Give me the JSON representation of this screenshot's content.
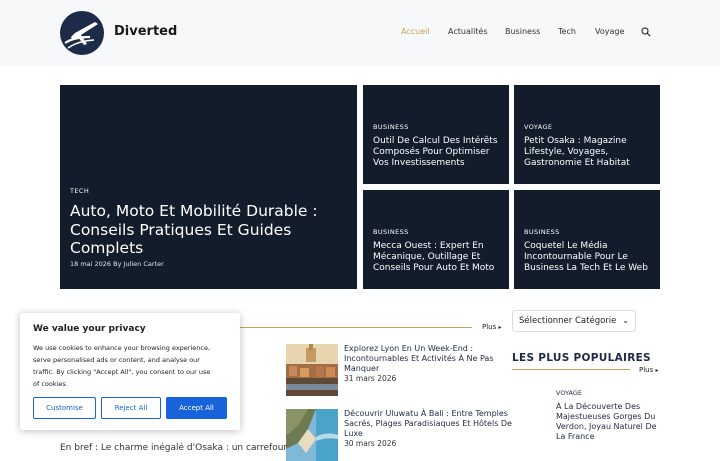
{
  "header": {
    "brand": "Diverted",
    "nav": [
      "Accueil",
      "Actualités",
      "Business",
      "Tech",
      "Voyage"
    ]
  },
  "featured": {
    "main": {
      "category": "TECH",
      "title_lines": [
        "Auto, Moto Et Mobilité Durable :",
        "Conseils Pratiques Et Guides",
        "Complets"
      ],
      "date": "18 mai 2026",
      "byline": "By Julien Carter"
    },
    "tiles": [
      {
        "category": "BUSINESS",
        "title_lines": [
          "Outil De Calcul Des Intérêts",
          "Composés Pour Optimiser",
          "Vos Investissements"
        ]
      },
      {
        "category": "VOYAGE",
        "title_lines": [
          "Petit Osaka : Magazine",
          "Lifestyle, Voyages,",
          "Gastronomie Et Habitat"
        ]
      },
      {
        "category": "BUSINESS",
        "title_lines": [
          "Mecca Ouest : Expert En",
          "Mécanique, Outillage Et",
          "Conseils Pour Auto Et Moto"
        ]
      },
      {
        "category": "BUSINESS",
        "title_lines": [
          "Coquetel Le Média",
          "Incontournable Pour Le",
          "Business La Tech Et Le Web"
        ]
      }
    ]
  },
  "section": {
    "more_label": "Plus"
  },
  "posts": [
    {
      "title_lines": [
        "Explorez Lyon En Un Week-End :",
        "Incontournables Et Activités À Ne Pas",
        "Manquer"
      ],
      "date": "31 mars 2026"
    },
    {
      "title_lines": [
        "Découvrir Uluwatu À Bali : Entre Temples",
        "Sacrés, Plages Paradisiaques Et Hôtels De",
        "Luxe"
      ],
      "date": "30 mars 2026"
    }
  ],
  "excerpt": "En bref : Le charme inégalé d'Osaka : un carrefour",
  "sidebar": {
    "category_select": "Sélectionner Catégorie",
    "popular_heading": "LES PLUS POPULAIRES",
    "more_label": "Plus",
    "popular": [
      {
        "category": "VOYAGE",
        "title_lines": [
          "À La Découverte Des",
          "Majestueuses Gorges Du",
          "Verdon, Joyau Naturel De",
          "La France"
        ]
      }
    ]
  },
  "cookie": {
    "title": "We value your privacy",
    "text_lines": [
      "We use cookies to enhance your browsing experience,",
      "serve personalised ads or content, and analyse our",
      "traffic. By clicking \"Accept All\", you consent to our use",
      "of cookies."
    ],
    "customise": "Customise",
    "reject": "Reject All",
    "accept": "Accept All"
  },
  "colors": {
    "accent": "#caa14d",
    "tile_bg": "#131c2b",
    "cookie_button": "#1863dc"
  }
}
